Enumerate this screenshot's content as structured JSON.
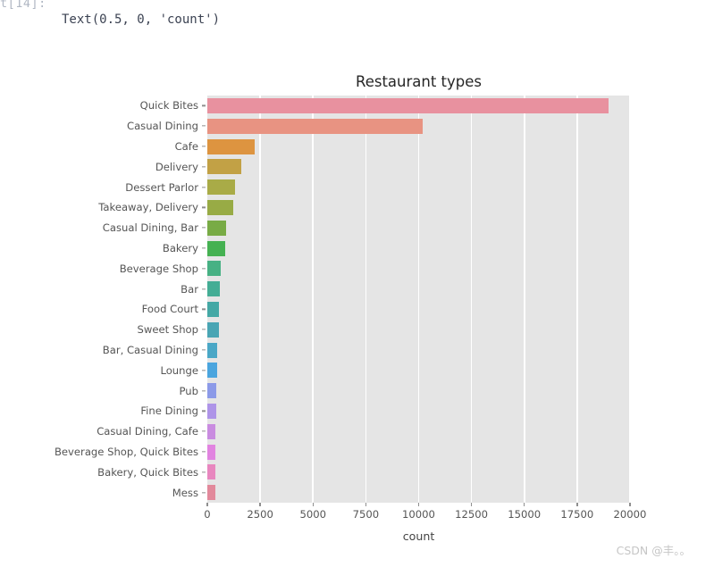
{
  "notebook": {
    "prompt": "t[14]:",
    "output_text": "Text(0.5, 0, 'count')"
  },
  "watermark": "CSDN @丰。。",
  "chart_data": {
    "type": "bar",
    "orientation": "horizontal",
    "title": "Restaurant types",
    "xlabel": "count",
    "ylabel": "",
    "xlim": [
      0,
      20000
    ],
    "xticks": [
      0,
      2500,
      5000,
      7500,
      10000,
      12500,
      15000,
      17500,
      20000
    ],
    "xticklabels": [
      "0",
      "2500",
      "5000",
      "7500",
      "10000",
      "12500",
      "15000",
      "17500",
      "20000"
    ],
    "grid": true,
    "grid_axis": "x",
    "legend": "none",
    "plot_background": "#e5e5e5",
    "categories": [
      "Quick Bites",
      "Casual Dining",
      "Cafe",
      "Delivery",
      "Dessert Parlor",
      "Takeaway, Delivery",
      "Casual Dining, Bar",
      "Bakery",
      "Beverage Shop",
      "Bar",
      "Food Court",
      "Sweet Shop",
      "Bar, Casual Dining",
      "Lounge",
      "Pub",
      "Fine Dining",
      "Casual Dining, Cafe",
      "Beverage Shop, Quick Bites",
      "Bakery, Quick Bites",
      "Mess"
    ],
    "values": [
      19000,
      10180,
      2230,
      1620,
      1320,
      1220,
      870,
      860,
      640,
      590,
      570,
      540,
      470,
      460,
      440,
      420,
      400,
      390,
      380,
      370
    ],
    "colors": [
      "#e8919f",
      "#e89382",
      "#dd9440",
      "#c2a145",
      "#a9ab47",
      "#98ab45",
      "#78ab45",
      "#45b152",
      "#47b184",
      "#44ad95",
      "#44a8a5",
      "#49a5b4",
      "#4aa7c6",
      "#4ba5de",
      "#8c9ae8",
      "#ae94e8",
      "#c98ce0",
      "#e184e0",
      "#e887bf",
      "#e2899b"
    ]
  }
}
